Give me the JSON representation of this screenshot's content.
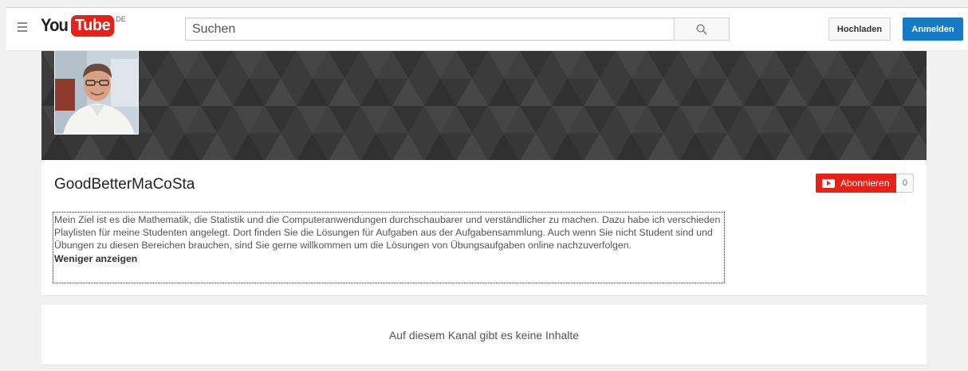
{
  "masthead": {
    "logo_you": "You",
    "logo_tube": "Tube",
    "logo_country": "DE",
    "search_placeholder": "Suchen",
    "upload_label": "Hochladen",
    "signin_label": "Anmelden"
  },
  "channel": {
    "name": "GoodBetterMaCoSta",
    "subscribe_label": "Abonnieren",
    "subscriber_count": "0",
    "about_text": "Mein Ziel ist es die Mathematik, die Statistik und die Computeranwendungen durchschaubarer und verständlicher zu machen. Dazu habe ich verschieden Playlisten für meine Studenten angelegt. Dort finden Sie die Lösungen für Aufgaben aus der Aufgabensammlung. Auch wenn Sie nicht Student sind und Übungen zu diesen Bereichen brauchen, sind Sie gerne willkommen um die Lösungen von Übungsaufgaben online nachzuverfolgen.",
    "show_less_label": "Weniger anzeigen",
    "empty_message": "Auf diesem Kanal gibt es keine Inhalte"
  },
  "colors": {
    "brand_red": "#e62117",
    "signin_blue": "#167ac6",
    "banner_dark": "#3a3a3a"
  },
  "icons": [
    "guide-menu-icon",
    "search-icon",
    "subscribe-play-icon"
  ]
}
